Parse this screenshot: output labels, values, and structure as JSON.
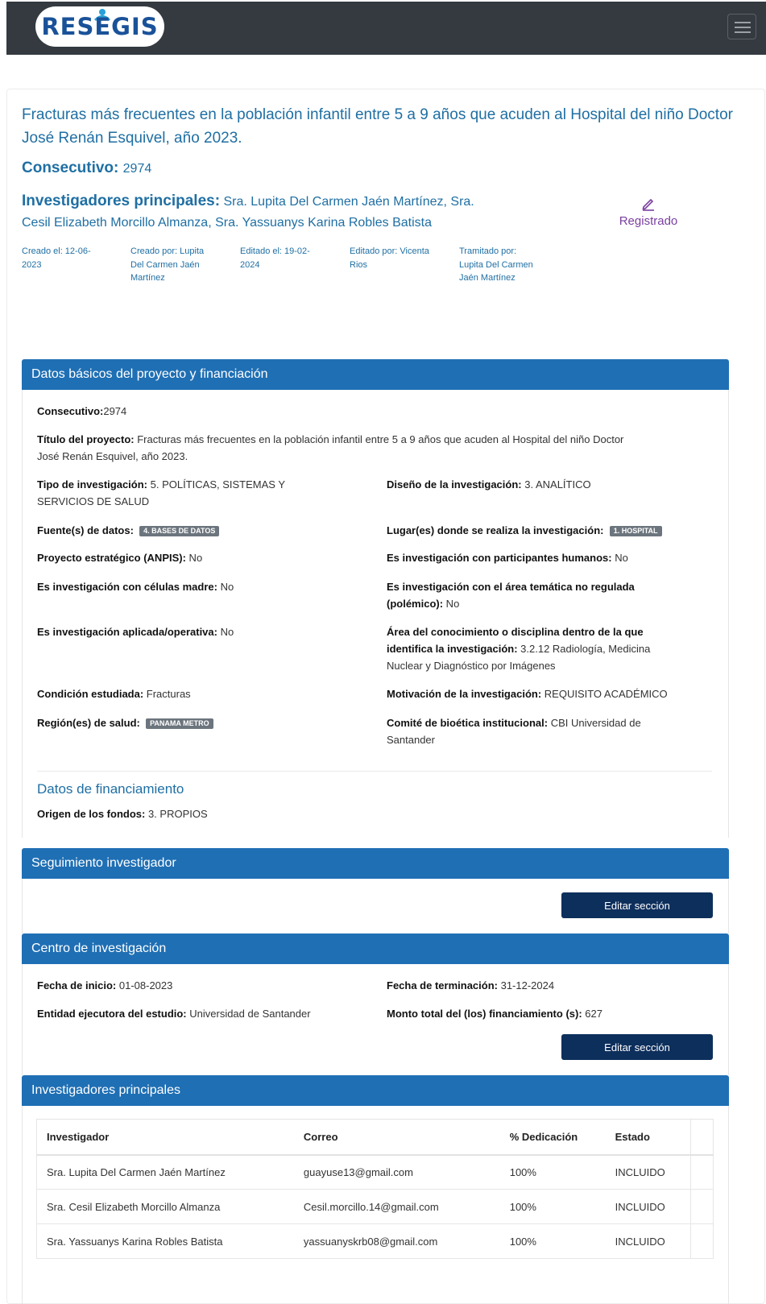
{
  "navbar": {
    "brand": "RESEGIS",
    "menu_icon": "hamburger-menu-icon"
  },
  "header": {
    "title": "Fracturas más frecuentes en la población infantil entre 5 a 9 años que acuden al Hospital del niño Doctor José Renán Esquivel, año 2023.",
    "consecutivo_label": "Consecutivo:",
    "consecutivo_value": "2974",
    "investigadores_label": "Investigadores principales:",
    "investigadores_line1": "Sra. Lupita Del Carmen Jaén Martínez, Sra.",
    "investigadores_line2": "Cesil Elizabeth Morcillo Almanza, Sra. Yassuanys Karina Robles Batista",
    "status_icon": "pencil-icon",
    "status_label": "Registrado",
    "meta": [
      {
        "l1": "Creado el: 12-06-",
        "l2": "2023",
        "l3": ""
      },
      {
        "l1": "Creado por: Lupita",
        "l2": "Del Carmen Jaén",
        "l3": "Martínez"
      },
      {
        "l1": "Editado el: 19-02-",
        "l2": "2024",
        "l3": ""
      },
      {
        "l1": "Editado por: Vicenta",
        "l2": "Rios",
        "l3": ""
      },
      {
        "l1": "Tramitado por:",
        "l2": "Lupita Del Carmen",
        "l3": "Jaén Martínez"
      }
    ]
  },
  "basic": {
    "header": "Datos básicos del proyecto y financiación",
    "consecutivo_label": "Consecutivo:",
    "consecutivo_value": "2974",
    "titulo_label": "Título del proyecto:",
    "titulo_value1": " Fracturas más frecuentes en la población infantil entre 5 a 9 años que acuden al Hospital del niño Doctor",
    "titulo_value2": "José Renán Esquivel, año 2023.",
    "tipo_label": "Tipo de investigación:",
    "tipo_value1": " 5. POLÍTICAS, SISTEMAS Y",
    "tipo_value2": "SERVICIOS DE SALUD",
    "diseno_label": "Diseño de la investigación:",
    "diseno_value": " 3. ANALÍTICO",
    "fuente_label": "Fuente(s) de datos:",
    "fuente_badge": "4. BASES DE DATOS",
    "lugar_label": "Lugar(es) donde se realiza la investigación:",
    "lugar_badge": "1. HOSPITAL",
    "anpis_label": "Proyecto estratégico (ANPIS):",
    "anpis_value": " No",
    "humanos_label": "Es investigación con participantes humanos:",
    "humanos_value": " No",
    "celulas_label": "Es investigación con células madre:",
    "celulas_value": " No",
    "polemico_label1": "Es investigación con el área temática no regulada",
    "polemico_label2": "(polémico):",
    "polemico_value": " No",
    "aplicada_label": "Es investigación aplicada/operativa:",
    "aplicada_value": " No",
    "area_label1": "Área del conocimiento o disciplina dentro de la que",
    "area_label2": "identifica la investigación:",
    "area_value1": " 3.2.12 Radiología, Medicina",
    "area_value2": "Nuclear y Diagnóstico por Imágenes",
    "condicion_label": "Condición estudiada:",
    "condicion_value": " Fracturas",
    "motivacion_label": "Motivación de la investigación:",
    "motivacion_value": " REQUISITO ACADÉMICO",
    "region_label": "Región(es) de salud:",
    "region_badge": "PANAMA METRO",
    "comite_label": "Comité de bioética institucional:",
    "comite_value1": " CBI Universidad de",
    "comite_value2": "Santander",
    "financ_header": "Datos de financiamiento",
    "origen_label": "Origen de los fondos:",
    "origen_value": " 3. PROPIOS"
  },
  "seguimiento": {
    "header": "Seguimiento investigador",
    "button": "Editar sección"
  },
  "centro": {
    "header": "Centro de investigación",
    "inicio_label": "Fecha de inicio:",
    "inicio_value": " 01-08-2023",
    "fin_label": "Fecha de terminación:",
    "fin_value": " 31-12-2024",
    "entidad_label": "Entidad ejecutora del estudio:",
    "entidad_value": " Universidad de Santander",
    "monto_label": "Monto total del (los) financiamiento (s):",
    "monto_value": " 627",
    "button": "Editar sección"
  },
  "investigadores": {
    "header": "Investigadores principales",
    "columns": [
      "Investigador",
      "Correo",
      "% Dedicación",
      "Estado"
    ],
    "rows": [
      [
        "Sra. Lupita Del Carmen Jaén Martínez",
        "guayuse13@gmail.com",
        "100%",
        "INCLUIDO"
      ],
      [
        "Sra. Cesil Elizabeth Morcillo Almanza",
        "Cesil.morcillo.14@gmail.com",
        "100%",
        "INCLUIDO"
      ],
      [
        "Sra. Yassuanys Karina Robles Batista",
        "yassuanyskrb08@gmail.com",
        "100%",
        "INCLUIDO"
      ]
    ]
  },
  "colors": {
    "navbar": "#343a40",
    "section_header": "#1f6fb4",
    "title_blue": "#1f6fa3",
    "button": "#0d2f5c",
    "registrado": "#7a3fa0"
  }
}
